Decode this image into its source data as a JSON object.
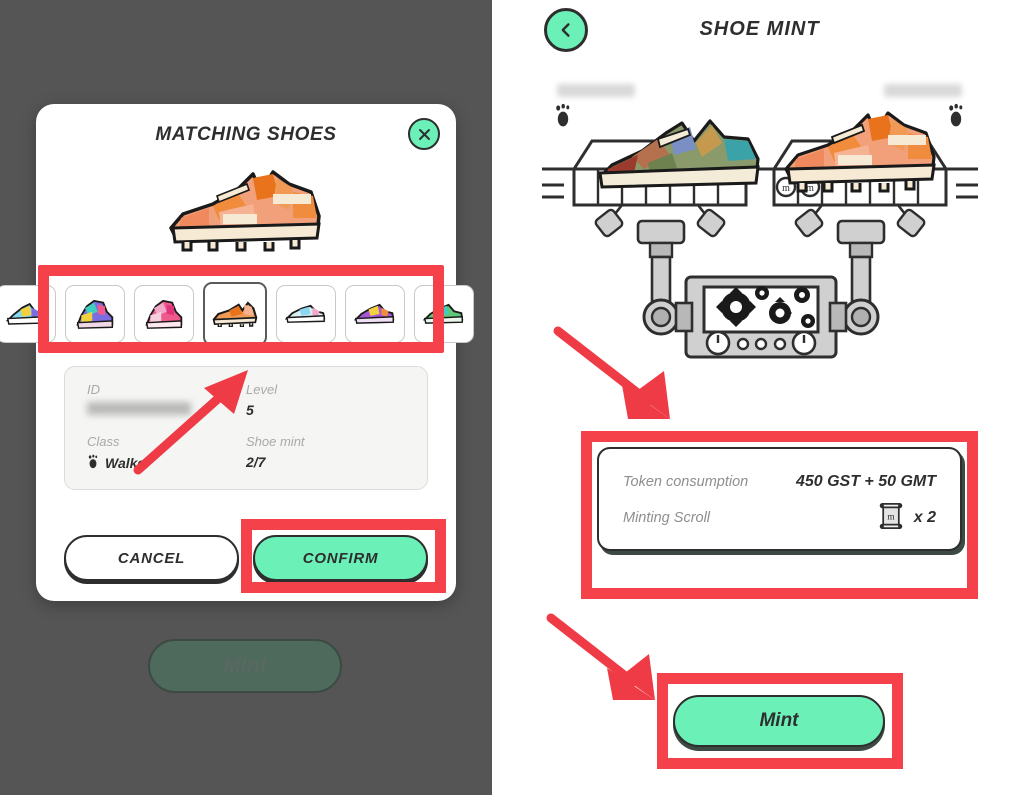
{
  "accent": {
    "mint": "#6BF0B8",
    "red_highlight": "#F4414A",
    "ink": "#2e2e2e",
    "dim_overlay": "#555555"
  },
  "left_panel": {
    "background": {
      "shoe_id_blurred": "",
      "plus_symbol": "+",
      "mint_button_label": "Mint",
      "footprint_icon": "footprint-icon"
    },
    "modal": {
      "title": "MATCHING SHOES",
      "close_icon": "close-icon",
      "hero_shoe_alt": "orange-cleat-shoe",
      "carousel": {
        "items": [
          {
            "name": "shoe-thumb-1",
            "selected": false
          },
          {
            "name": "shoe-thumb-2",
            "selected": false
          },
          {
            "name": "shoe-thumb-3",
            "selected": false
          },
          {
            "name": "shoe-thumb-4",
            "selected": true
          },
          {
            "name": "shoe-thumb-5",
            "selected": false
          },
          {
            "name": "shoe-thumb-6",
            "selected": false
          },
          {
            "name": "shoe-thumb-7",
            "selected": false
          }
        ]
      },
      "details": {
        "id_label": "ID",
        "id_value": "",
        "level_label": "Level",
        "level_value": "5",
        "class_label": "Class",
        "class_value": "Walker",
        "class_icon": "footprint-icon",
        "shoe_mint_label": "Shoe mint",
        "shoe_mint_value": "2/7"
      },
      "cancel_label": "CANCEL",
      "confirm_label": "CONFIRM"
    }
  },
  "right_panel": {
    "back_icon": "chevron-left-icon",
    "title": "SHOE MINT",
    "left_shoe_id_blurred": "",
    "right_shoe_id_blurred": "",
    "machine_alt": "shoe-minting-machine",
    "token_card": {
      "token_consumption_label": "Token consumption",
      "token_consumption_value": "450 GST + 50 GMT",
      "minting_scroll_label": "Minting Scroll",
      "minting_scroll_icon": "scroll-icon",
      "minting_scroll_count": "x 2"
    },
    "mint_button_label": "Mint"
  },
  "annotations": {
    "arrow_to_detail": "red-arrow-up-right",
    "arrow_to_token": "red-arrow-down-right",
    "arrow_to_mint": "red-arrow-down-right",
    "highlight_carousel": "red-rect-carousel",
    "highlight_confirm": "red-rect-confirm",
    "highlight_token": "red-rect-token-card",
    "highlight_mint": "red-rect-mint-button"
  }
}
